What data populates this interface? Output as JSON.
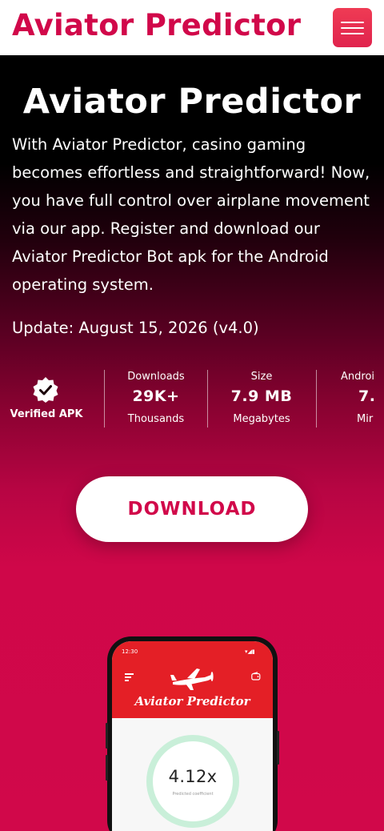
{
  "header": {
    "brand": "Aviator Predictor",
    "menu_icon": "hamburger-menu-icon",
    "brand_color": "#d1084a"
  },
  "hero": {
    "title": "Aviator Predictor",
    "description": "With Aviator Predictor, casino gaming becomes effortless and straightforward! Now, you have full control over airplane movement via our app. Register and download our Aviator Predictor Bot apk for the Android operating system.",
    "update": "Update: August 15, 2026 (v4.0)"
  },
  "stats": {
    "verified_label": "Verified APK",
    "verified_icon": "verified-badge-icon",
    "items": [
      {
        "label": "Downloads",
        "value": "29K+",
        "unit": "Thousands"
      },
      {
        "label": "Size",
        "value": "7.9 MB",
        "unit": "Megabytes"
      },
      {
        "label": "Androi",
        "value": "7.",
        "unit": "Mir"
      }
    ]
  },
  "download_label": "DOWNLOAD",
  "phone": {
    "time": "12:30",
    "app_title": "Aviator Predictor",
    "coefficient": "4.12x",
    "coefficient_label": "Predicted coefficient",
    "accent": "#e41f26",
    "ring_color": "#c9efd9"
  }
}
